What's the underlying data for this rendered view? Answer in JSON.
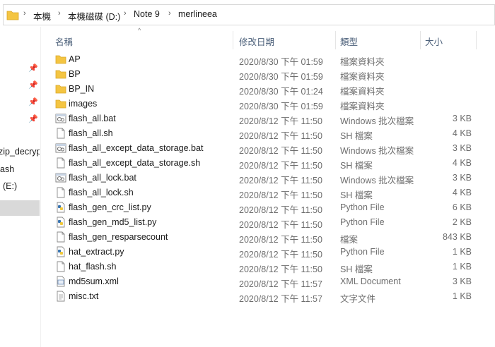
{
  "breadcrumb": [
    "本機",
    "本機磁碟 (D:)",
    "Note 9",
    "merlineea"
  ],
  "nav": {
    "items": [
      "zip_decryp",
      "ash",
      "(E:)"
    ]
  },
  "columns": {
    "name": "名稱",
    "date": "修改日期",
    "type": "類型",
    "size": "大小"
  },
  "files": [
    {
      "name": "AP",
      "date": "2020/8/30 下午 01:59",
      "type": "檔案資料夾",
      "size": "",
      "icon": "folder-icon"
    },
    {
      "name": "BP",
      "date": "2020/8/30 下午 01:59",
      "type": "檔案資料夾",
      "size": "",
      "icon": "folder-icon"
    },
    {
      "name": "BP_IN",
      "date": "2020/8/30 下午 01:24",
      "type": "檔案資料夾",
      "size": "",
      "icon": "folder-icon"
    },
    {
      "name": "images",
      "date": "2020/8/30 下午 01:59",
      "type": "檔案資料夾",
      "size": "",
      "icon": "folder-icon"
    },
    {
      "name": "flash_all.bat",
      "date": "2020/8/12 下午 11:50",
      "type": "Windows 批次檔案",
      "size": "3 KB",
      "icon": "batch-file-icon"
    },
    {
      "name": "flash_all.sh",
      "date": "2020/8/12 下午 11:50",
      "type": "SH 檔案",
      "size": "4 KB",
      "icon": "file-icon"
    },
    {
      "name": "flash_all_except_data_storage.bat",
      "date": "2020/8/12 下午 11:50",
      "type": "Windows 批次檔案",
      "size": "3 KB",
      "icon": "batch-file-icon"
    },
    {
      "name": "flash_all_except_data_storage.sh",
      "date": "2020/8/12 下午 11:50",
      "type": "SH 檔案",
      "size": "4 KB",
      "icon": "file-icon"
    },
    {
      "name": "flash_all_lock.bat",
      "date": "2020/8/12 下午 11:50",
      "type": "Windows 批次檔案",
      "size": "3 KB",
      "icon": "batch-file-icon"
    },
    {
      "name": "flash_all_lock.sh",
      "date": "2020/8/12 下午 11:50",
      "type": "SH 檔案",
      "size": "4 KB",
      "icon": "file-icon"
    },
    {
      "name": "flash_gen_crc_list.py",
      "date": "2020/8/12 下午 11:50",
      "type": "Python File",
      "size": "6 KB",
      "icon": "python-file-icon"
    },
    {
      "name": "flash_gen_md5_list.py",
      "date": "2020/8/12 下午 11:50",
      "type": "Python File",
      "size": "2 KB",
      "icon": "python-file-icon"
    },
    {
      "name": "flash_gen_resparsecount",
      "date": "2020/8/12 下午 11:50",
      "type": "檔案",
      "size": "843 KB",
      "icon": "file-icon"
    },
    {
      "name": "hat_extract.py",
      "date": "2020/8/12 下午 11:50",
      "type": "Python File",
      "size": "1 KB",
      "icon": "python-file-icon"
    },
    {
      "name": "hat_flash.sh",
      "date": "2020/8/12 下午 11:50",
      "type": "SH 檔案",
      "size": "1 KB",
      "icon": "file-icon"
    },
    {
      "name": "md5sum.xml",
      "date": "2020/8/12 下午 11:57",
      "type": "XML Document",
      "size": "3 KB",
      "icon": "xml-file-icon"
    },
    {
      "name": "misc.txt",
      "date": "2020/8/12 下午 11:57",
      "type": "文字文件",
      "size": "1 KB",
      "icon": "text-file-icon"
    }
  ],
  "colors": {
    "folder": "#f4c542",
    "header_text": "#4c607a",
    "selected": "#d9d9d9"
  }
}
